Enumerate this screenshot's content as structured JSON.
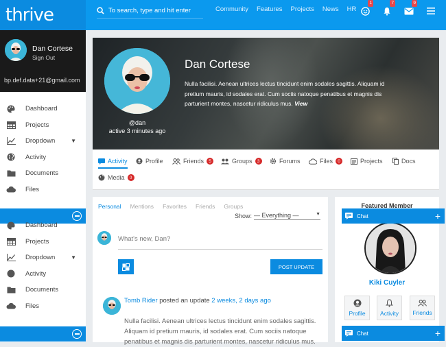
{
  "brand": {
    "logo_text": "thrive"
  },
  "search": {
    "placeholder": "To search, type and hit enter"
  },
  "nav": [
    "Community",
    "Features",
    "Projects",
    "News",
    "HR"
  ],
  "top_icons": [
    {
      "icon": "smiley-icon",
      "badge": "1"
    },
    {
      "icon": "bell-icon",
      "badge": "7"
    },
    {
      "icon": "mail-icon",
      "badge": "9"
    },
    {
      "icon": "hamburger-menu-icon",
      "badge": ""
    }
  ],
  "sidebar": {
    "user_name": "Dan Cortese",
    "sign_out": "Sign Out",
    "email": "bp.def.data+21@gmail.com",
    "menu_top": [
      {
        "label": "Dashboard",
        "icon": "palette-icon"
      },
      {
        "label": "Projects",
        "icon": "grid-icon"
      },
      {
        "label": "Dropdown",
        "icon": "chart-line-icon",
        "caret": true
      },
      {
        "label": "Activity",
        "icon": "globe-icon"
      },
      {
        "label": "Documents",
        "icon": "folder-icon"
      },
      {
        "label": "Files",
        "icon": "cloud-icon"
      }
    ],
    "menu_bottom": [
      {
        "label": "Dashboard",
        "icon": "palette-icon"
      },
      {
        "label": "Projects",
        "icon": "grid-icon"
      },
      {
        "label": "Dropdown",
        "icon": "chart-line-icon",
        "caret": true
      },
      {
        "label": "Activity",
        "icon": "globe-icon"
      },
      {
        "label": "Documents",
        "icon": "folder-icon"
      },
      {
        "label": "Files",
        "icon": "cloud-icon"
      }
    ]
  },
  "profile": {
    "name": "Dan Cortese",
    "handle": "@dan",
    "active": "active 3 minutes ago",
    "bio": "Nulla facilisi. Aenean ultrices lectus tincidunt enim sodales sagittis. Aliquam id pretium mauris, id sodales erat. Cum sociis natoque penatibus et magnis dis parturient montes, nascetur ridiculus mus.",
    "view_link": "View"
  },
  "profile_tabs": [
    {
      "label": "Activity",
      "count": ""
    },
    {
      "label": "Profile",
      "count": ""
    },
    {
      "label": "Friends",
      "count": "5"
    },
    {
      "label": "Groups",
      "count": "3"
    },
    {
      "label": "Forums",
      "count": ""
    },
    {
      "label": "Files",
      "count": "0"
    },
    {
      "label": "Projects",
      "count": ""
    },
    {
      "label": "Docs",
      "count": ""
    },
    {
      "label": "Media",
      "count": "0"
    }
  ],
  "feed": {
    "subtabs": [
      "Personal",
      "Mentions",
      "Favorites",
      "Friends",
      "Groups"
    ],
    "show_label": "Show:",
    "show_value": "— Everything —",
    "whats_new": "What's new, Dan?",
    "post_button": "POST UPDATE",
    "activity": {
      "user": "Tomb Rider",
      "action": "posted an update",
      "time": "2 weeks, 2 days ago",
      "body": "Nulla facilisi. Aenean ultrices lectus tincidunt enim sodales sagittis. Aliquam id pretium mauris, id sodales erat. Cum sociis natoque penatibus et magnis dis parturient montes, nascetur ridiculus mus."
    }
  },
  "featured": {
    "title": "Featured Member",
    "name": "Kiki Cuyler",
    "buttons": [
      "Profile",
      "Activity",
      "Friends"
    ]
  },
  "chat": {
    "label": "Chat"
  },
  "colors": {
    "accent": "#0b99ee",
    "accent_dark": "#0b8be0",
    "badge": "#e5484d"
  }
}
